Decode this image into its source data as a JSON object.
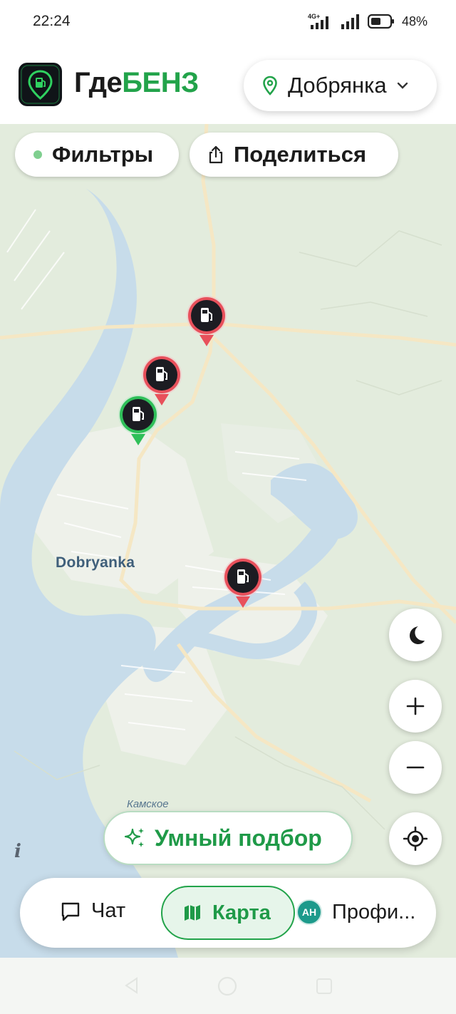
{
  "status_bar": {
    "time": "22:24",
    "network": "4G+",
    "battery": "48%"
  },
  "header": {
    "app_name_part1": "Где",
    "app_name_part2": "БЕНЗ",
    "city": "Добрянка"
  },
  "map": {
    "filters_label": "Фильтры",
    "share_label": "Поделиться",
    "city_label": "Dobryanka",
    "water_label": "Камское",
    "info_glyph": "i",
    "smart_pick_label": "Умный подбор",
    "station_markers": [
      {
        "status": "red"
      },
      {
        "status": "red"
      },
      {
        "status": "green"
      },
      {
        "status": "red"
      }
    ]
  },
  "colors": {
    "brand_green": "#22a34a",
    "marker_red": "#e8505b",
    "marker_green": "#2fbf59",
    "marker_body": "#1c1c22"
  },
  "bottom_nav": {
    "chat_label": "Чат",
    "map_label": "Карта",
    "profile_label": "Профи...",
    "avatar_initials": "АН"
  }
}
